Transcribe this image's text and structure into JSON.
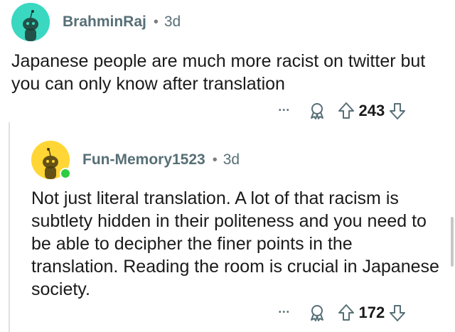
{
  "comment1": {
    "username": "BrahminRaj",
    "separator": "•",
    "time": "3d",
    "body": "Japanese people are much more racist on twitter but you can only know after translation",
    "more": "•••",
    "score": "243",
    "avatar_color": "#3ad8c1"
  },
  "comment2": {
    "username": "Fun-Memory1523",
    "separator": "•",
    "time": "3d",
    "body": "Not just literal translation. A lot of that racism is subtlety hidden in their politeness and you need to be able to decipher the finer points in the translation. Reading the room is crucial in Japanese society.",
    "more": "•••",
    "score": "172",
    "avatar_color": "#ffd635",
    "online": true
  },
  "icons": [
    "award-icon",
    "upvote-icon",
    "downvote-icon"
  ]
}
